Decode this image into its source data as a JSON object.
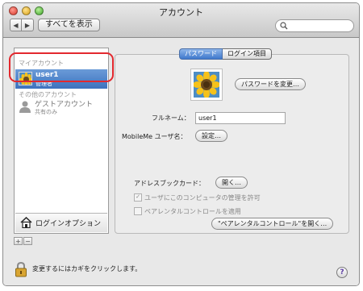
{
  "window": {
    "title": "アカウント"
  },
  "toolbar": {
    "back_label": "◀",
    "forward_label": "▶",
    "show_all_label": "すべてを表示",
    "search_placeholder": ""
  },
  "sidebar": {
    "my_account_header": "マイアカウント",
    "other_accounts_header": "その他のアカウント",
    "selected_user": {
      "name": "user1",
      "role": "管理者"
    },
    "guest": {
      "name": "ゲストアカウント",
      "sub": "共有のみ"
    },
    "login_options_label": "ログインオプション",
    "add_label": "+",
    "remove_label": "−"
  },
  "tabs": [
    {
      "label": "パスワード",
      "active": true
    },
    {
      "label": "ログイン項目",
      "active": false
    }
  ],
  "main": {
    "change_password_label": "パスワードを変更…",
    "fullname_label": "フルネーム：",
    "fullname_value": "user1",
    "mobileme_label": "MobileMe ユーザ名：",
    "settings_button": "設定…",
    "addressbook_label": "アドレスブックカード：",
    "open_button": "開く…",
    "allow_admin_label": "ユーザにこのコンピュータの管理を許可",
    "allow_admin_checked": true,
    "parental_label": "ペアレンタルコントロールを適用",
    "parental_checked": false,
    "open_parental_button": "\"ペアレンタルコントロール\"を開く…"
  },
  "footer": {
    "lock_text": "変更するにはカギをクリックします。",
    "help_label": "?"
  },
  "colors": {
    "selection": "#3d72be",
    "highlight_ring": "#e3282e"
  }
}
